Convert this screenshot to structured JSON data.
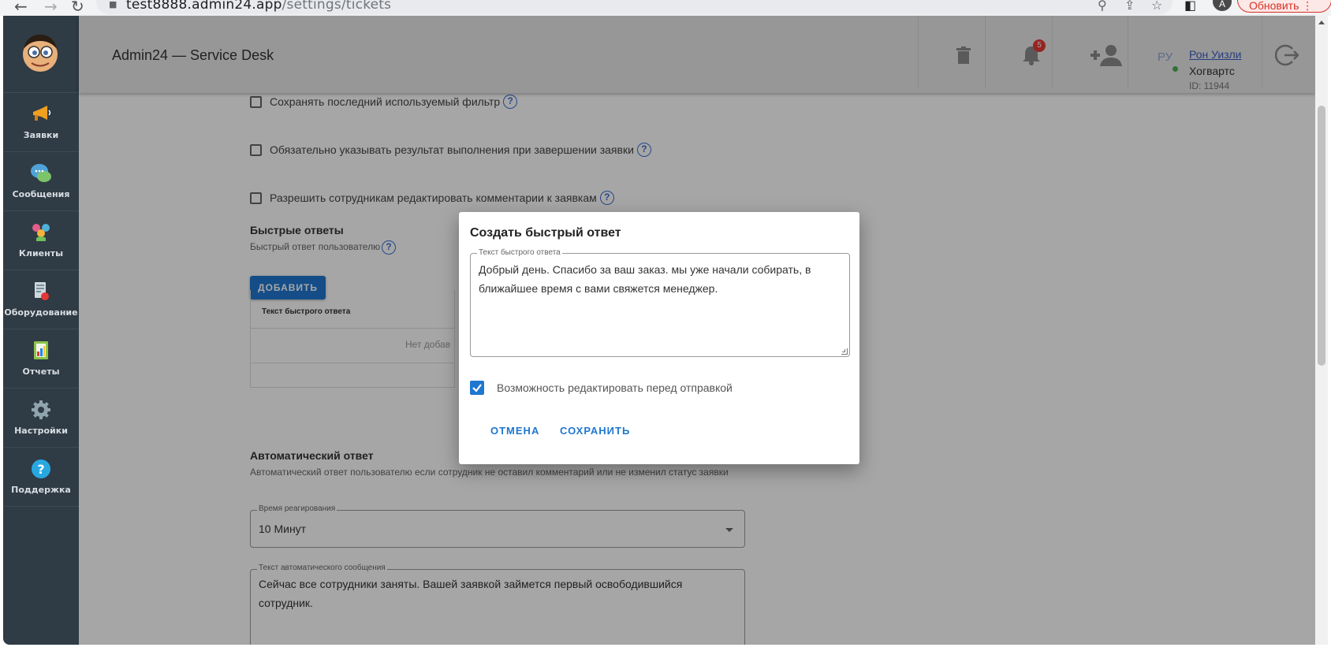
{
  "browser": {
    "url_host": "test8888.admin24.app",
    "url_path": "/settings/tickets",
    "profile_initial": "A",
    "update_label": "Обновить"
  },
  "sidebar": {
    "items": [
      {
        "label": "Заявки",
        "icon": "megaphone-icon"
      },
      {
        "label": "Сообщения",
        "icon": "chat-bubble-icon"
      },
      {
        "label": "Клиенты",
        "icon": "users-group-icon"
      },
      {
        "label": "Оборудование",
        "icon": "equipment-icon"
      },
      {
        "label": "Отчеты",
        "icon": "report-chart-icon"
      },
      {
        "label": "Настройки",
        "icon": "gear-icon"
      },
      {
        "label": "Поддержка",
        "icon": "help-icon"
      }
    ]
  },
  "header": {
    "title": "Admin24 — Service Desk",
    "notifications_count": "5",
    "lang": "РУ",
    "user_name": "Рон Уизли",
    "user_org": "Хогвартс",
    "user_id": "ID: 11944"
  },
  "settings": {
    "checkbox_save_filter": "Сохранять последний используемый фильтр",
    "checkbox_require_result": "Обязательно указывать результат выполнения при завершении заявки",
    "checkbox_edit_comments": "Разрешить сотрудникам редактировать комментарии к заявкам",
    "quick_replies_title": "Быстрые ответы",
    "quick_replies_subtitle": "Быстрый ответ пользователю",
    "add_button": "ДОБАВИТЬ",
    "table_header": "Текст быстрого ответа",
    "table_empty": "Нет добав",
    "auto_reply_title": "Автоматический ответ",
    "auto_reply_subtitle": "Автоматический ответ пользователю если сотрудник не оставил комментарий или не изменил статус заявки",
    "reaction_time_label": "Время реагирования",
    "reaction_time_value": "10 Минут",
    "auto_message_label": "Текст автоматического сообщения",
    "auto_message_value": "Сейчас все сотрудники заняты. Вашей заявкой займется первый освободившийся сотрудник."
  },
  "dialog": {
    "title": "Создать быстрый ответ",
    "field_label": "Текст быстрого ответа",
    "field_value": "Добрый день. Спасибо за ваш заказ. мы уже начали собирать, в ближайшее время с вами свяжется менеджер.",
    "checkbox_label": "Возможность редактировать перед отправкой",
    "checkbox_checked": true,
    "cancel_label": "ОТМЕНА",
    "save_label": "СОХРАНИТЬ"
  },
  "colors": {
    "accent": "#1f77d0",
    "sidebar_bg": "#2f3b45",
    "badge": "#e53935",
    "update": "#d93025"
  }
}
